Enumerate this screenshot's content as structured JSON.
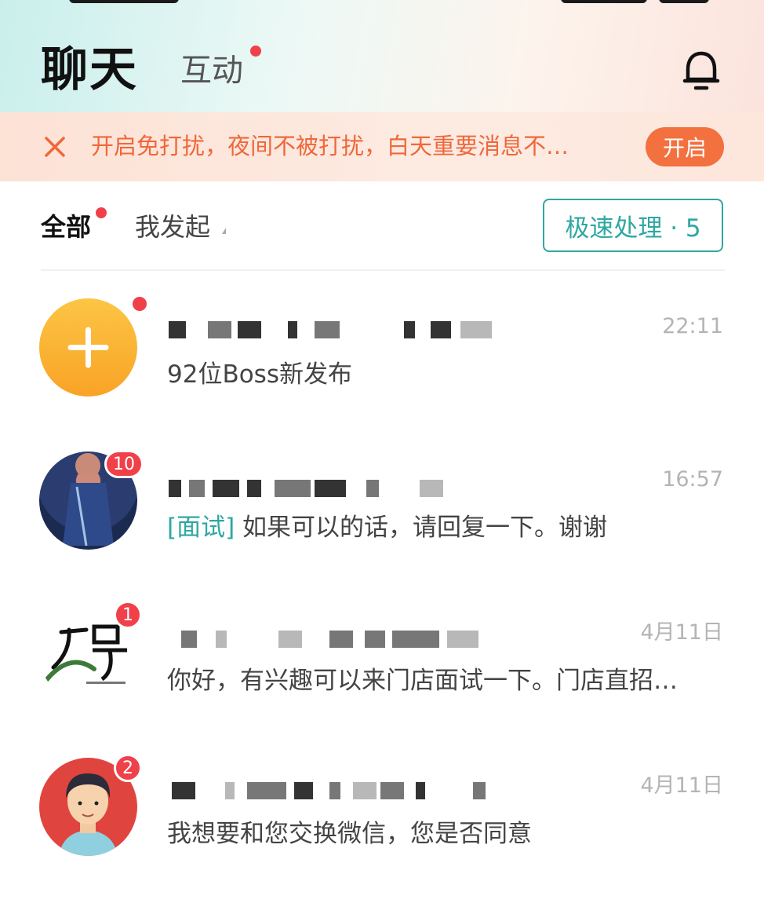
{
  "header": {
    "title": "聊天",
    "tab_interact": "互动"
  },
  "banner": {
    "text": "开启免打扰，夜间不被打扰，白天重要消息不…",
    "button": "开启"
  },
  "filters": {
    "all": "全部",
    "mine": "我发起",
    "quick_button": "极速处理 · 5"
  },
  "chats": [
    {
      "time": "22:11",
      "tag": "",
      "message": "92位Boss新发布",
      "badge": ""
    },
    {
      "time": "16:57",
      "tag": "[面试]",
      "message": " 如果可以的话，请回复一下。谢谢",
      "badge": "10"
    },
    {
      "time": "4月11日",
      "tag": "",
      "message": "你好，有兴趣可以来门店面试一下。门店直招…",
      "badge": "1"
    },
    {
      "time": "4月11日",
      "tag": "",
      "message": "我想要和您交换微信，您是否同意",
      "badge": "2"
    }
  ],
  "colors": {
    "accent_teal": "#2fa7a1",
    "accent_orange": "#f3703f",
    "badge_red": "#f0404a"
  }
}
